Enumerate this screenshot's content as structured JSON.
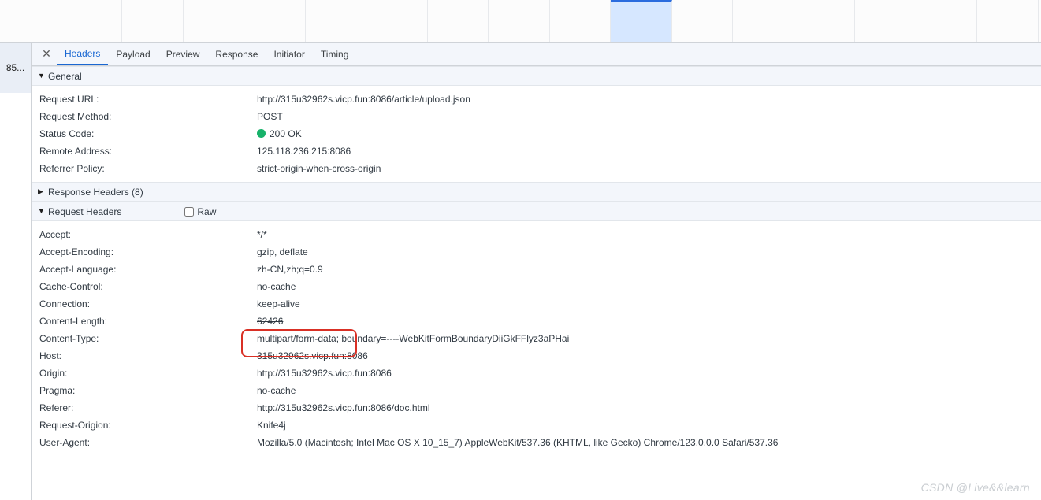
{
  "side_item": "85...",
  "tabs": {
    "headers": "Headers",
    "payload": "Payload",
    "preview": "Preview",
    "response": "Response",
    "initiator": "Initiator",
    "timing": "Timing"
  },
  "sections": {
    "general": "General",
    "response_headers": "Response Headers (8)",
    "request_headers": "Request Headers",
    "raw_label": "Raw"
  },
  "general": [
    {
      "k": "Request URL:",
      "v": "http://315u32962s.vicp.fun:8086/article/upload.json"
    },
    {
      "k": "Request Method:",
      "v": "POST"
    },
    {
      "k": "Status Code:",
      "v": "200 OK",
      "status": true
    },
    {
      "k": "Remote Address:",
      "v": "125.118.236.215:8086"
    },
    {
      "k": "Referrer Policy:",
      "v": "strict-origin-when-cross-origin"
    }
  ],
  "request_headers": [
    {
      "k": "Accept:",
      "v": "*/*"
    },
    {
      "k": "Accept-Encoding:",
      "v": "gzip, deflate"
    },
    {
      "k": "Accept-Language:",
      "v": "zh-CN,zh;q=0.9"
    },
    {
      "k": "Cache-Control:",
      "v": "no-cache"
    },
    {
      "k": "Connection:",
      "v": "keep-alive"
    },
    {
      "k": "Content-Length:",
      "v_pre": "62426",
      "strike": true
    },
    {
      "k": "Content-Type:",
      "v_pre": "multipart/form-data; ",
      "v_post": "boundary=----WebKitFormBoundaryDiiGkFFlyz3aPHai",
      "boxed": true
    },
    {
      "k": "Host:",
      "v": "315u32962s.vicp.fun:8086"
    },
    {
      "k": "Origin:",
      "v": "http://315u32962s.vicp.fun:8086"
    },
    {
      "k": "Pragma:",
      "v": "no-cache"
    },
    {
      "k": "Referer:",
      "v": "http://315u32962s.vicp.fun:8086/doc.html"
    },
    {
      "k": "Request-Origion:",
      "v": "Knife4j"
    },
    {
      "k": "User-Agent:",
      "v": "Mozilla/5.0 (Macintosh; Intel Mac OS X 10_15_7) AppleWebKit/537.36 (KHTML, like Gecko) Chrome/123.0.0.0 Safari/537.36"
    }
  ],
  "watermark": "CSDN @Live&&learn"
}
